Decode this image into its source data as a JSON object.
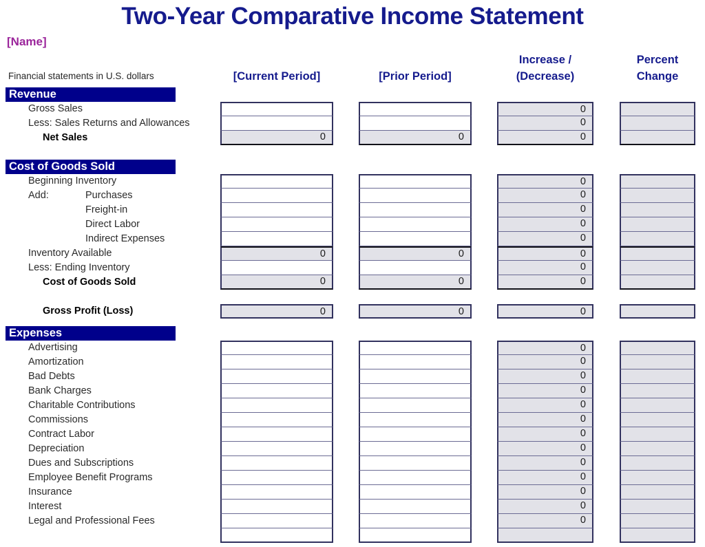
{
  "document": {
    "title": "Two-Year Comparative Income Statement",
    "name_placeholder": "[Name]",
    "subtitle": "Financial statements in U.S. dollars",
    "title_color": "#151B8D",
    "name_color": "#9B259B",
    "section_bar_color": "#00008B",
    "calc_cell_color": "#e2e2e8"
  },
  "columns": [
    {
      "key": "current",
      "label": "[Current Period]"
    },
    {
      "key": "prior",
      "label": "[Prior Period]"
    },
    {
      "key": "increase",
      "label_line1": "Increase /",
      "label_line2": "(Decrease)"
    },
    {
      "key": "percent",
      "label_line1": "Percent",
      "label_line2": "Change"
    }
  ],
  "sections": [
    {
      "heading": "Revenue",
      "rows": [
        {
          "label": "Gross Sales",
          "indent": "ind1",
          "values": {
            "current": "",
            "prior": "",
            "increase": "0",
            "percent": ""
          }
        },
        {
          "label": "Less: Sales Returns and Allowances",
          "indent": "ind1",
          "values": {
            "current": "",
            "prior": "",
            "increase": "0",
            "percent": ""
          }
        },
        {
          "label": "Net Sales",
          "indent": "total1",
          "total": true,
          "values": {
            "current": "0",
            "prior": "0",
            "increase": "0",
            "percent": ""
          }
        }
      ]
    },
    {
      "heading": "Cost of Goods Sold",
      "rows": [
        {
          "label": "Beginning Inventory",
          "indent": "ind1",
          "values": {
            "current": "",
            "prior": "",
            "increase": "0",
            "percent": ""
          }
        },
        {
          "label": "Add:",
          "label2": "Purchases",
          "indent": "ind1",
          "values": {
            "current": "",
            "prior": "",
            "increase": "0",
            "percent": ""
          }
        },
        {
          "label": "Freight-in",
          "indent": "ind3",
          "values": {
            "current": "",
            "prior": "",
            "increase": "0",
            "percent": ""
          }
        },
        {
          "label": "Direct Labor",
          "indent": "ind3",
          "values": {
            "current": "",
            "prior": "",
            "increase": "0",
            "percent": ""
          }
        },
        {
          "label": "Indirect Expenses",
          "indent": "ind3",
          "values": {
            "current": "",
            "prior": "",
            "increase": "0",
            "percent": ""
          }
        },
        {
          "label": "Inventory Available",
          "indent": "ind1",
          "subtotal": true,
          "values": {
            "current": "0",
            "prior": "0",
            "increase": "0",
            "percent": ""
          }
        },
        {
          "label": "Less: Ending Inventory",
          "indent": "ind1",
          "values": {
            "current": "",
            "prior": "",
            "increase": "0",
            "percent": ""
          }
        },
        {
          "label": "Cost of Goods Sold",
          "indent": "total1",
          "total": true,
          "values": {
            "current": "0",
            "prior": "0",
            "increase": "0",
            "percent": ""
          }
        }
      ]
    },
    {
      "heading": null,
      "rows": [
        {
          "label": "Gross Profit (Loss)",
          "indent": "total1",
          "standalone": true,
          "values": {
            "current": "0",
            "prior": "0",
            "increase": "0",
            "percent": ""
          }
        }
      ]
    },
    {
      "heading": "Expenses",
      "rows": [
        {
          "label": "Advertising",
          "indent": "ind1",
          "values": {
            "current": "",
            "prior": "",
            "increase": "0",
            "percent": ""
          }
        },
        {
          "label": "Amortization",
          "indent": "ind1",
          "values": {
            "current": "",
            "prior": "",
            "increase": "0",
            "percent": ""
          }
        },
        {
          "label": "Bad Debts",
          "indent": "ind1",
          "values": {
            "current": "",
            "prior": "",
            "increase": "0",
            "percent": ""
          }
        },
        {
          "label": "Bank Charges",
          "indent": "ind1",
          "values": {
            "current": "",
            "prior": "",
            "increase": "0",
            "percent": ""
          }
        },
        {
          "label": "Charitable Contributions",
          "indent": "ind1",
          "values": {
            "current": "",
            "prior": "",
            "increase": "0",
            "percent": ""
          }
        },
        {
          "label": "Commissions",
          "indent": "ind1",
          "values": {
            "current": "",
            "prior": "",
            "increase": "0",
            "percent": ""
          }
        },
        {
          "label": "Contract Labor",
          "indent": "ind1",
          "values": {
            "current": "",
            "prior": "",
            "increase": "0",
            "percent": ""
          }
        },
        {
          "label": "Depreciation",
          "indent": "ind1",
          "values": {
            "current": "",
            "prior": "",
            "increase": "0",
            "percent": ""
          }
        },
        {
          "label": "Dues and Subscriptions",
          "indent": "ind1",
          "values": {
            "current": "",
            "prior": "",
            "increase": "0",
            "percent": ""
          }
        },
        {
          "label": "Employee Benefit Programs",
          "indent": "ind1",
          "values": {
            "current": "",
            "prior": "",
            "increase": "0",
            "percent": ""
          }
        },
        {
          "label": "Insurance",
          "indent": "ind1",
          "values": {
            "current": "",
            "prior": "",
            "increase": "0",
            "percent": ""
          }
        },
        {
          "label": "Interest",
          "indent": "ind1",
          "values": {
            "current": "",
            "prior": "",
            "increase": "0",
            "percent": ""
          }
        },
        {
          "label": "Legal and Professional Fees",
          "indent": "ind1",
          "values": {
            "current": "",
            "prior": "",
            "increase": "0",
            "percent": ""
          }
        },
        {
          "label": "",
          "indent": "ind1",
          "clipped": true,
          "values": {
            "current": "",
            "prior": "",
            "increase": "",
            "percent": ""
          }
        }
      ]
    }
  ]
}
